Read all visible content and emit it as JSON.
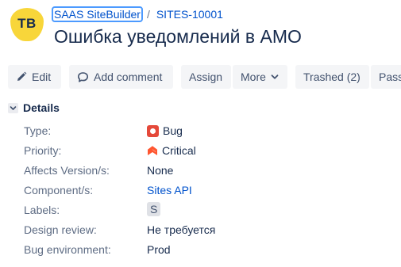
{
  "project": {
    "avatar_initials": "TB",
    "name": "SAAS SiteBuilder"
  },
  "issue": {
    "key": "SITES-10001",
    "title": "Ошибка уведомлений в АМО"
  },
  "breadcrumb_separator": "/",
  "toolbar": {
    "edit": "Edit",
    "add_comment": "Add comment",
    "assign": "Assign",
    "more": "More",
    "trashed": "Trashed (2)",
    "pass": "Pass"
  },
  "details": {
    "heading": "Details",
    "fields": {
      "type": {
        "label": "Type:",
        "value": "Bug",
        "icon": "bug-icon"
      },
      "priority": {
        "label": "Priority:",
        "value": "Critical",
        "icon": "critical-priority-icon"
      },
      "affects_versions": {
        "label": "Affects Version/s:",
        "value": "None"
      },
      "components": {
        "label": "Component/s:",
        "value": "Sites API"
      },
      "labels": {
        "label": "Labels:",
        "value": "S"
      },
      "design_review": {
        "label": "Design review:",
        "value": "Не требуется"
      },
      "bug_environment": {
        "label": "Bug environment:",
        "value": "Prod"
      }
    }
  },
  "colors": {
    "link": "#0052cc",
    "bug": "#e5493a",
    "critical": "#ff5630",
    "avatar": "#f8d63a",
    "button_bg": "#f4f5f7"
  }
}
